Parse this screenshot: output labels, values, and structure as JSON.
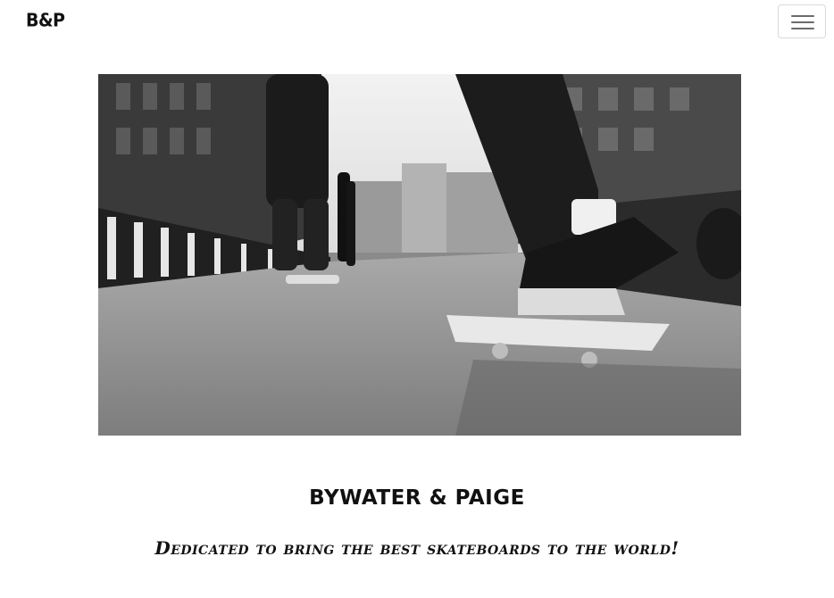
{
  "navbar": {
    "brand": "B&P",
    "toggler_icon": "hamburger-menu-icon"
  },
  "hero": {
    "image_alt": "skateboarders-street-photo"
  },
  "main": {
    "title": "Bywater & Paige",
    "tagline": "Dedicated to bring the best skateboards to the world!"
  }
}
